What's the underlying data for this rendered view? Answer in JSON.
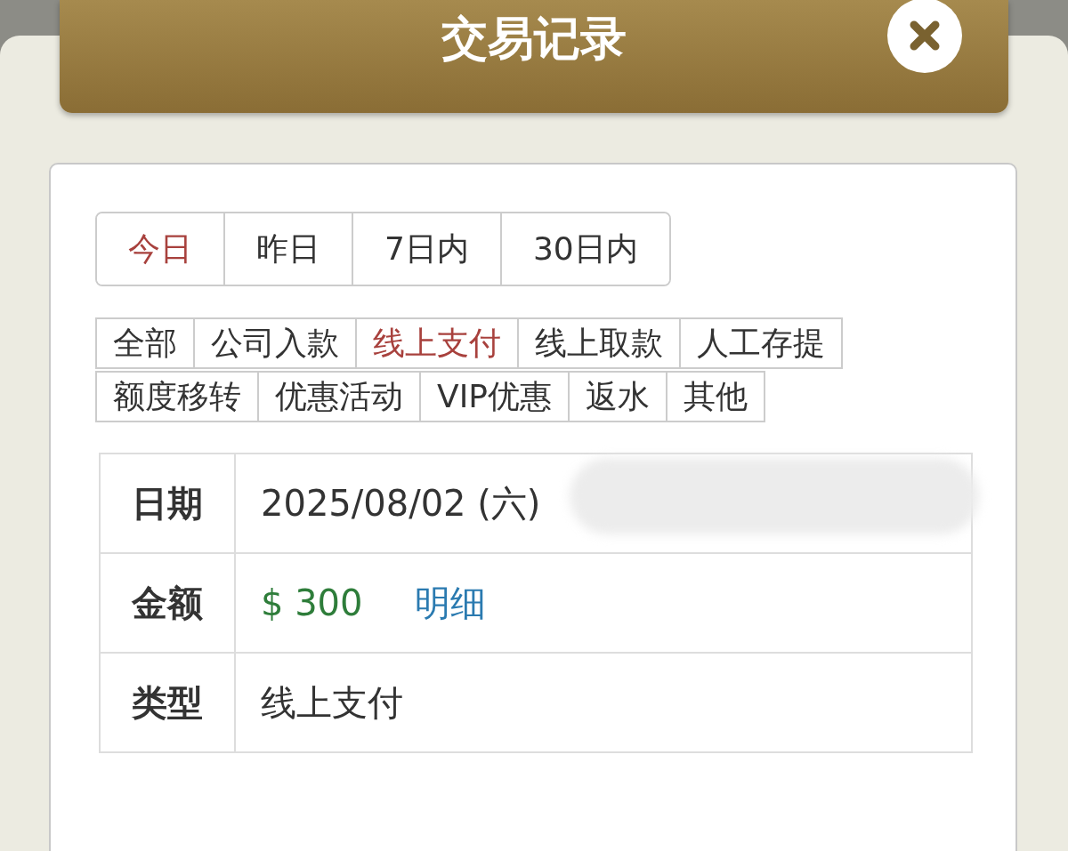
{
  "dialog": {
    "title": "交易记录"
  },
  "date_tabs": [
    {
      "label": "今日",
      "selected": true
    },
    {
      "label": "昨日",
      "selected": false
    },
    {
      "label": "7日内",
      "selected": false
    },
    {
      "label": "30日内",
      "selected": false
    }
  ],
  "type_tabs": [
    [
      {
        "label": "全部",
        "selected": false
      },
      {
        "label": "公司入款",
        "selected": false
      },
      {
        "label": "线上支付",
        "selected": true
      },
      {
        "label": "线上取款",
        "selected": false
      },
      {
        "label": "人工存提",
        "selected": false
      }
    ],
    [
      {
        "label": "额度移转",
        "selected": false
      },
      {
        "label": "优惠活动",
        "selected": false
      },
      {
        "label": "VIP优惠",
        "selected": false
      },
      {
        "label": "返水",
        "selected": false
      },
      {
        "label": "其他",
        "selected": false
      }
    ]
  ],
  "record": [
    {
      "kind": "date",
      "label": "日期",
      "value": "2025/08/02 (六)"
    },
    {
      "kind": "amount",
      "label": "金额",
      "value": "$ 300",
      "link": "明细"
    },
    {
      "kind": "text",
      "label": "类型",
      "value": "线上支付"
    }
  ]
}
